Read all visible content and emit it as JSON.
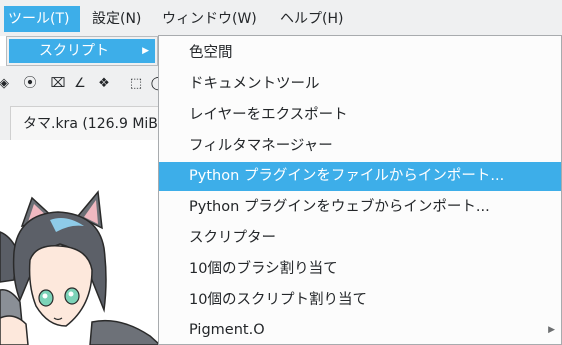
{
  "menubar": {
    "items": [
      {
        "label": "ツール(T)"
      },
      {
        "label": "設定(N)"
      },
      {
        "label": "ウィンドウ(W)"
      },
      {
        "label": "ヘルプ(H)"
      }
    ]
  },
  "tools_menu": {
    "scripts_label": "スクリプト"
  },
  "document_tab": {
    "title": "タマ.kra (126.9 MiB"
  },
  "scripts_menu": {
    "items": [
      {
        "label": "色空間"
      },
      {
        "label": "ドキュメントツール"
      },
      {
        "label": "レイヤーをエクスポート"
      },
      {
        "label": "フィルタマネージャー"
      },
      {
        "label": "Python プラグインをファイルからインポート..."
      },
      {
        "label": "Python プラグインをウェブからインポート..."
      },
      {
        "label": "スクリプター"
      },
      {
        "label": "10個のブラシ割り当て"
      },
      {
        "label": "10個のスクリプト割り当て"
      },
      {
        "label": "Pigment.O"
      }
    ],
    "highlighted_index": 4
  },
  "colors": {
    "accent": "#3daee9",
    "menubar_bg": "#eff0f1",
    "menu_bg": "#fcfcfc"
  }
}
